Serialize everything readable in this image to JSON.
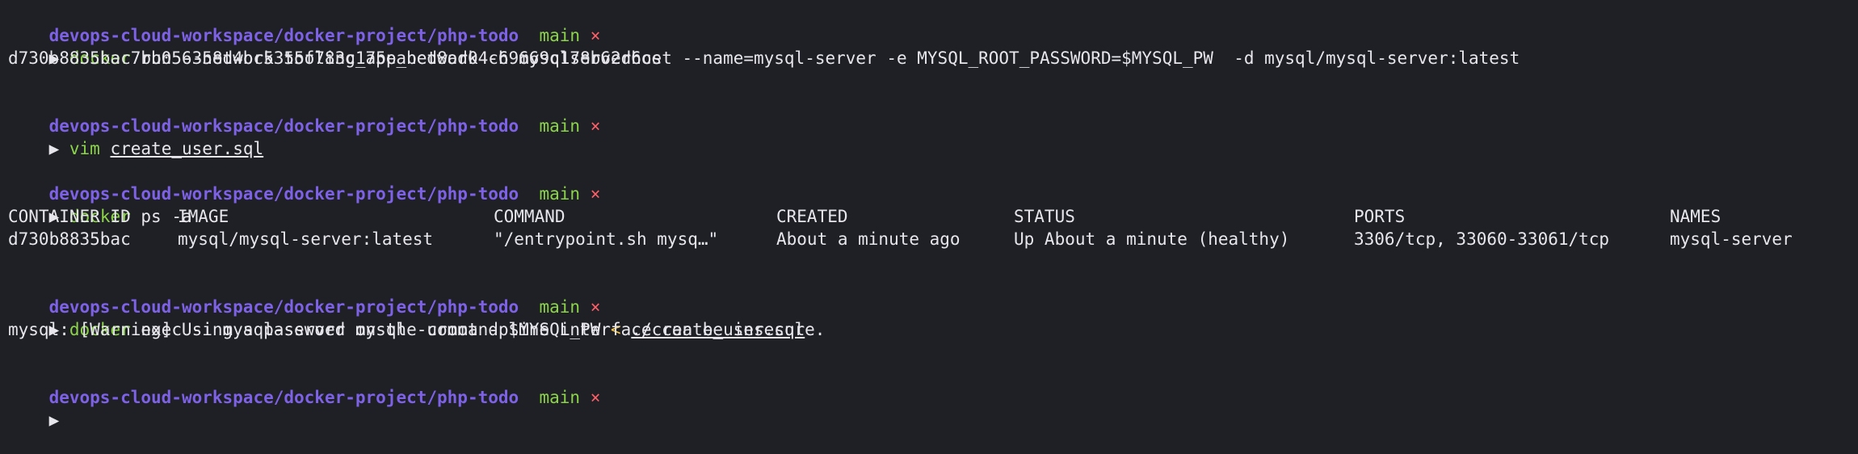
{
  "prompt": {
    "path": "devops-cloud-workspace/docker-project/php-todo",
    "branch": "main",
    "dirty_marker": "×",
    "arrow": "▶"
  },
  "blocks": [
    {
      "command": "docker",
      "args": " run --network tooling_app_network -h mysqlserverhost --name=mysql-server -e MYSQL_ROOT_PASSWORD=$MYSQL_PW  -d mysql/mysql-server:latest",
      "output": [
        "d730b8835bac7bb056358d4bc5355f783c175eabed8ad04c69669c178b62d6ce"
      ]
    },
    {
      "command": "vim",
      "underlined_arg": "create_user.sql"
    },
    {
      "command": "docker",
      "args": " ps -a",
      "table": {
        "headers": [
          "CONTAINER ID",
          "IMAGE",
          "COMMAND",
          "CREATED",
          "STATUS",
          "PORTS",
          "NAMES"
        ],
        "rows": [
          [
            "d730b8835bac",
            "mysql/mysql-server:latest",
            "\"/entrypoint.sh mysq…\"",
            "About a minute ago",
            "Up About a minute (healthy)",
            "3306/tcp, 33060-33061/tcp",
            "mysql-server"
          ]
        ]
      }
    },
    {
      "command": "docker",
      "args": " exec -i mysql-server mysql -uroot -p$MYSQL_PW ",
      "redirect": "<",
      "underlined_arg": "./create_user.sql",
      "output": [
        "mysql: [Warning] Using a password on the command line interface can be insecure."
      ]
    }
  ],
  "colors": {
    "background": "#1f1f26",
    "path": "#7d62e6",
    "branch": "#8bd448",
    "dirty": "#ff5f66",
    "command": "#8bd448",
    "text": "#e6e6ec"
  }
}
